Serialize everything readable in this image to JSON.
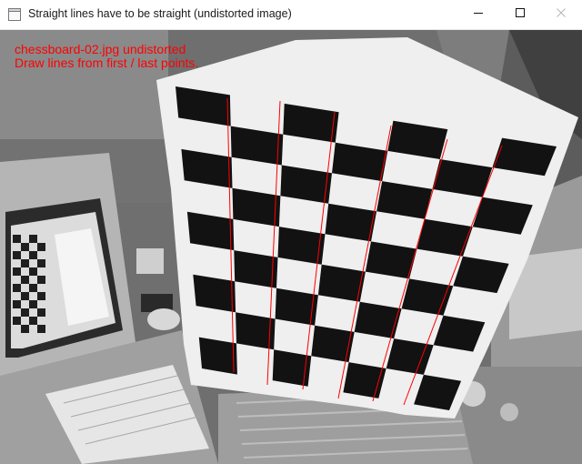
{
  "window": {
    "title": "Straight lines have to be straight (undistorted image)",
    "icons": {
      "app": "app-icon",
      "minimize": "minimize-icon",
      "maximize": "maximize-icon",
      "close": "close-icon"
    }
  },
  "overlay": {
    "line1": "chessboard-02.jpg undistorted",
    "line2": "Draw lines from first / last points.",
    "color": "#ff0000"
  },
  "colors": {
    "line_color": "#ff0000",
    "board_light": "#f2f2f2",
    "board_dark": "#121212"
  }
}
